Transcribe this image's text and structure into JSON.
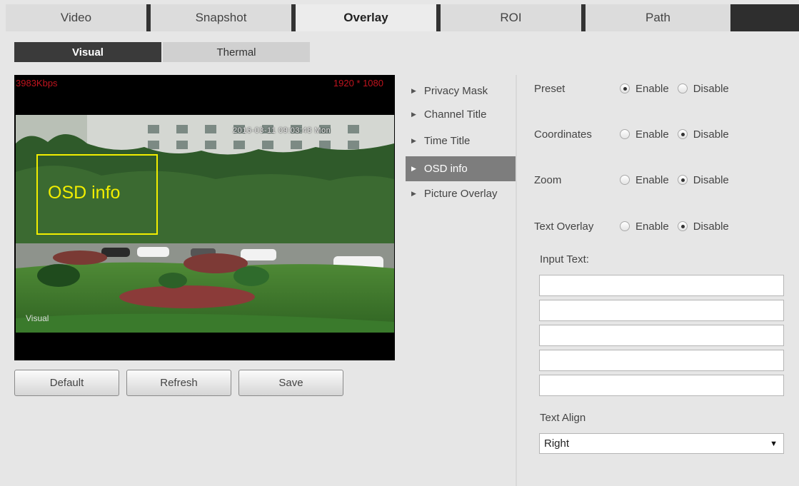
{
  "top_tabs": [
    {
      "label": "Video"
    },
    {
      "label": "Snapshot"
    },
    {
      "label": "Overlay"
    },
    {
      "label": "ROI"
    },
    {
      "label": "Path"
    }
  ],
  "active_top_tab": "Overlay",
  "sub_tabs": [
    {
      "label": "Visual"
    },
    {
      "label": "Thermal"
    }
  ],
  "preview": {
    "bitrate": "3983Kbps",
    "resolution": "1920 * 1080",
    "timestamp": "2016-03-11 09:03:48 Mon",
    "osd_label": "OSD info",
    "channel_name": "Visual"
  },
  "buttons": {
    "default": "Default",
    "refresh": "Refresh",
    "save": "Save"
  },
  "menu": [
    {
      "label": "Privacy Mask"
    },
    {
      "label": "Channel Title"
    },
    {
      "label": "Time Title"
    },
    {
      "label": "OSD info"
    },
    {
      "label": "Picture Overlay"
    }
  ],
  "active_menu": "OSD info",
  "settings": {
    "enable_label": "Enable",
    "disable_label": "Disable",
    "preset": {
      "label": "Preset",
      "value": "Enable"
    },
    "coordinates": {
      "label": "Coordinates",
      "value": "Disable"
    },
    "zoom": {
      "label": "Zoom",
      "value": "Disable"
    },
    "text_overlay": {
      "label": "Text Overlay",
      "value": "Disable"
    },
    "input_text_label": "Input Text:",
    "input_lines": [
      "",
      "",
      "",
      "",
      ""
    ],
    "text_align_label": "Text Align",
    "text_align_value": "Right"
  },
  "colors": {
    "active_tab_bg": "#3a3a3a",
    "osd_box": "#f2ee00",
    "overlay_red": "#c0141e",
    "menu_active": "#7d7d7d"
  }
}
